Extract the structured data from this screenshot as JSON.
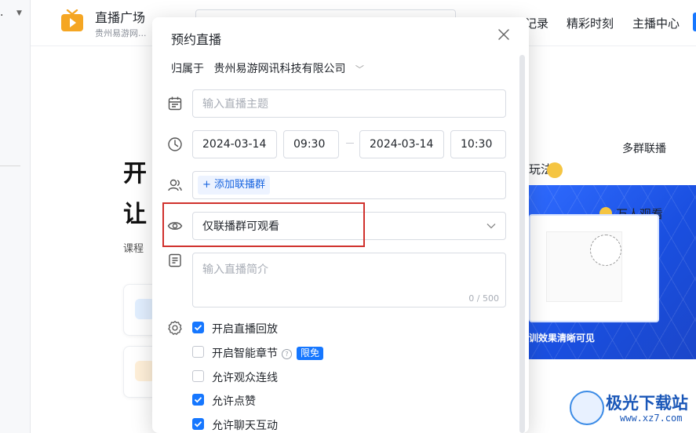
{
  "header": {
    "brand_title": "直播广场",
    "brand_subtitle": "贵州易游网...",
    "nav": [
      "记录",
      "精彩时刻",
      "主播中心"
    ]
  },
  "background": {
    "hero_line1": "开",
    "hero_line2": "让",
    "hero_small": "课程",
    "side_label": "多群联播",
    "side_play": "玩法",
    "promo_title": "万人观看",
    "promo_caption": "训效果清晰可见"
  },
  "watermark": {
    "title": "极光下载站",
    "url": "www.xz7.com"
  },
  "modal": {
    "title": "预约直播",
    "owner_label": "归属于",
    "owner_value": "贵州易游网讯科技有限公司",
    "topic_placeholder": "输入直播主题",
    "start_date": "2024-03-14",
    "start_time": "09:30",
    "end_date": "2024-03-14",
    "end_time": "10:30",
    "add_group_label": "添加联播群",
    "visibility_value": "仅联播群可观看",
    "intro_placeholder": "输入直播简介",
    "intro_counter": "0 / 500",
    "options": [
      {
        "label": "开启直播回放",
        "checked": true
      },
      {
        "label": "开启智能章节",
        "checked": false,
        "badge": "限免"
      },
      {
        "label": "允许观众连线",
        "checked": false
      },
      {
        "label": "允许点赞",
        "checked": true
      },
      {
        "label": "允许聊天互动",
        "checked": true
      }
    ]
  },
  "colors": {
    "accent": "#1677ff",
    "highlight": "#d0312d",
    "logo": "#f5a623"
  }
}
